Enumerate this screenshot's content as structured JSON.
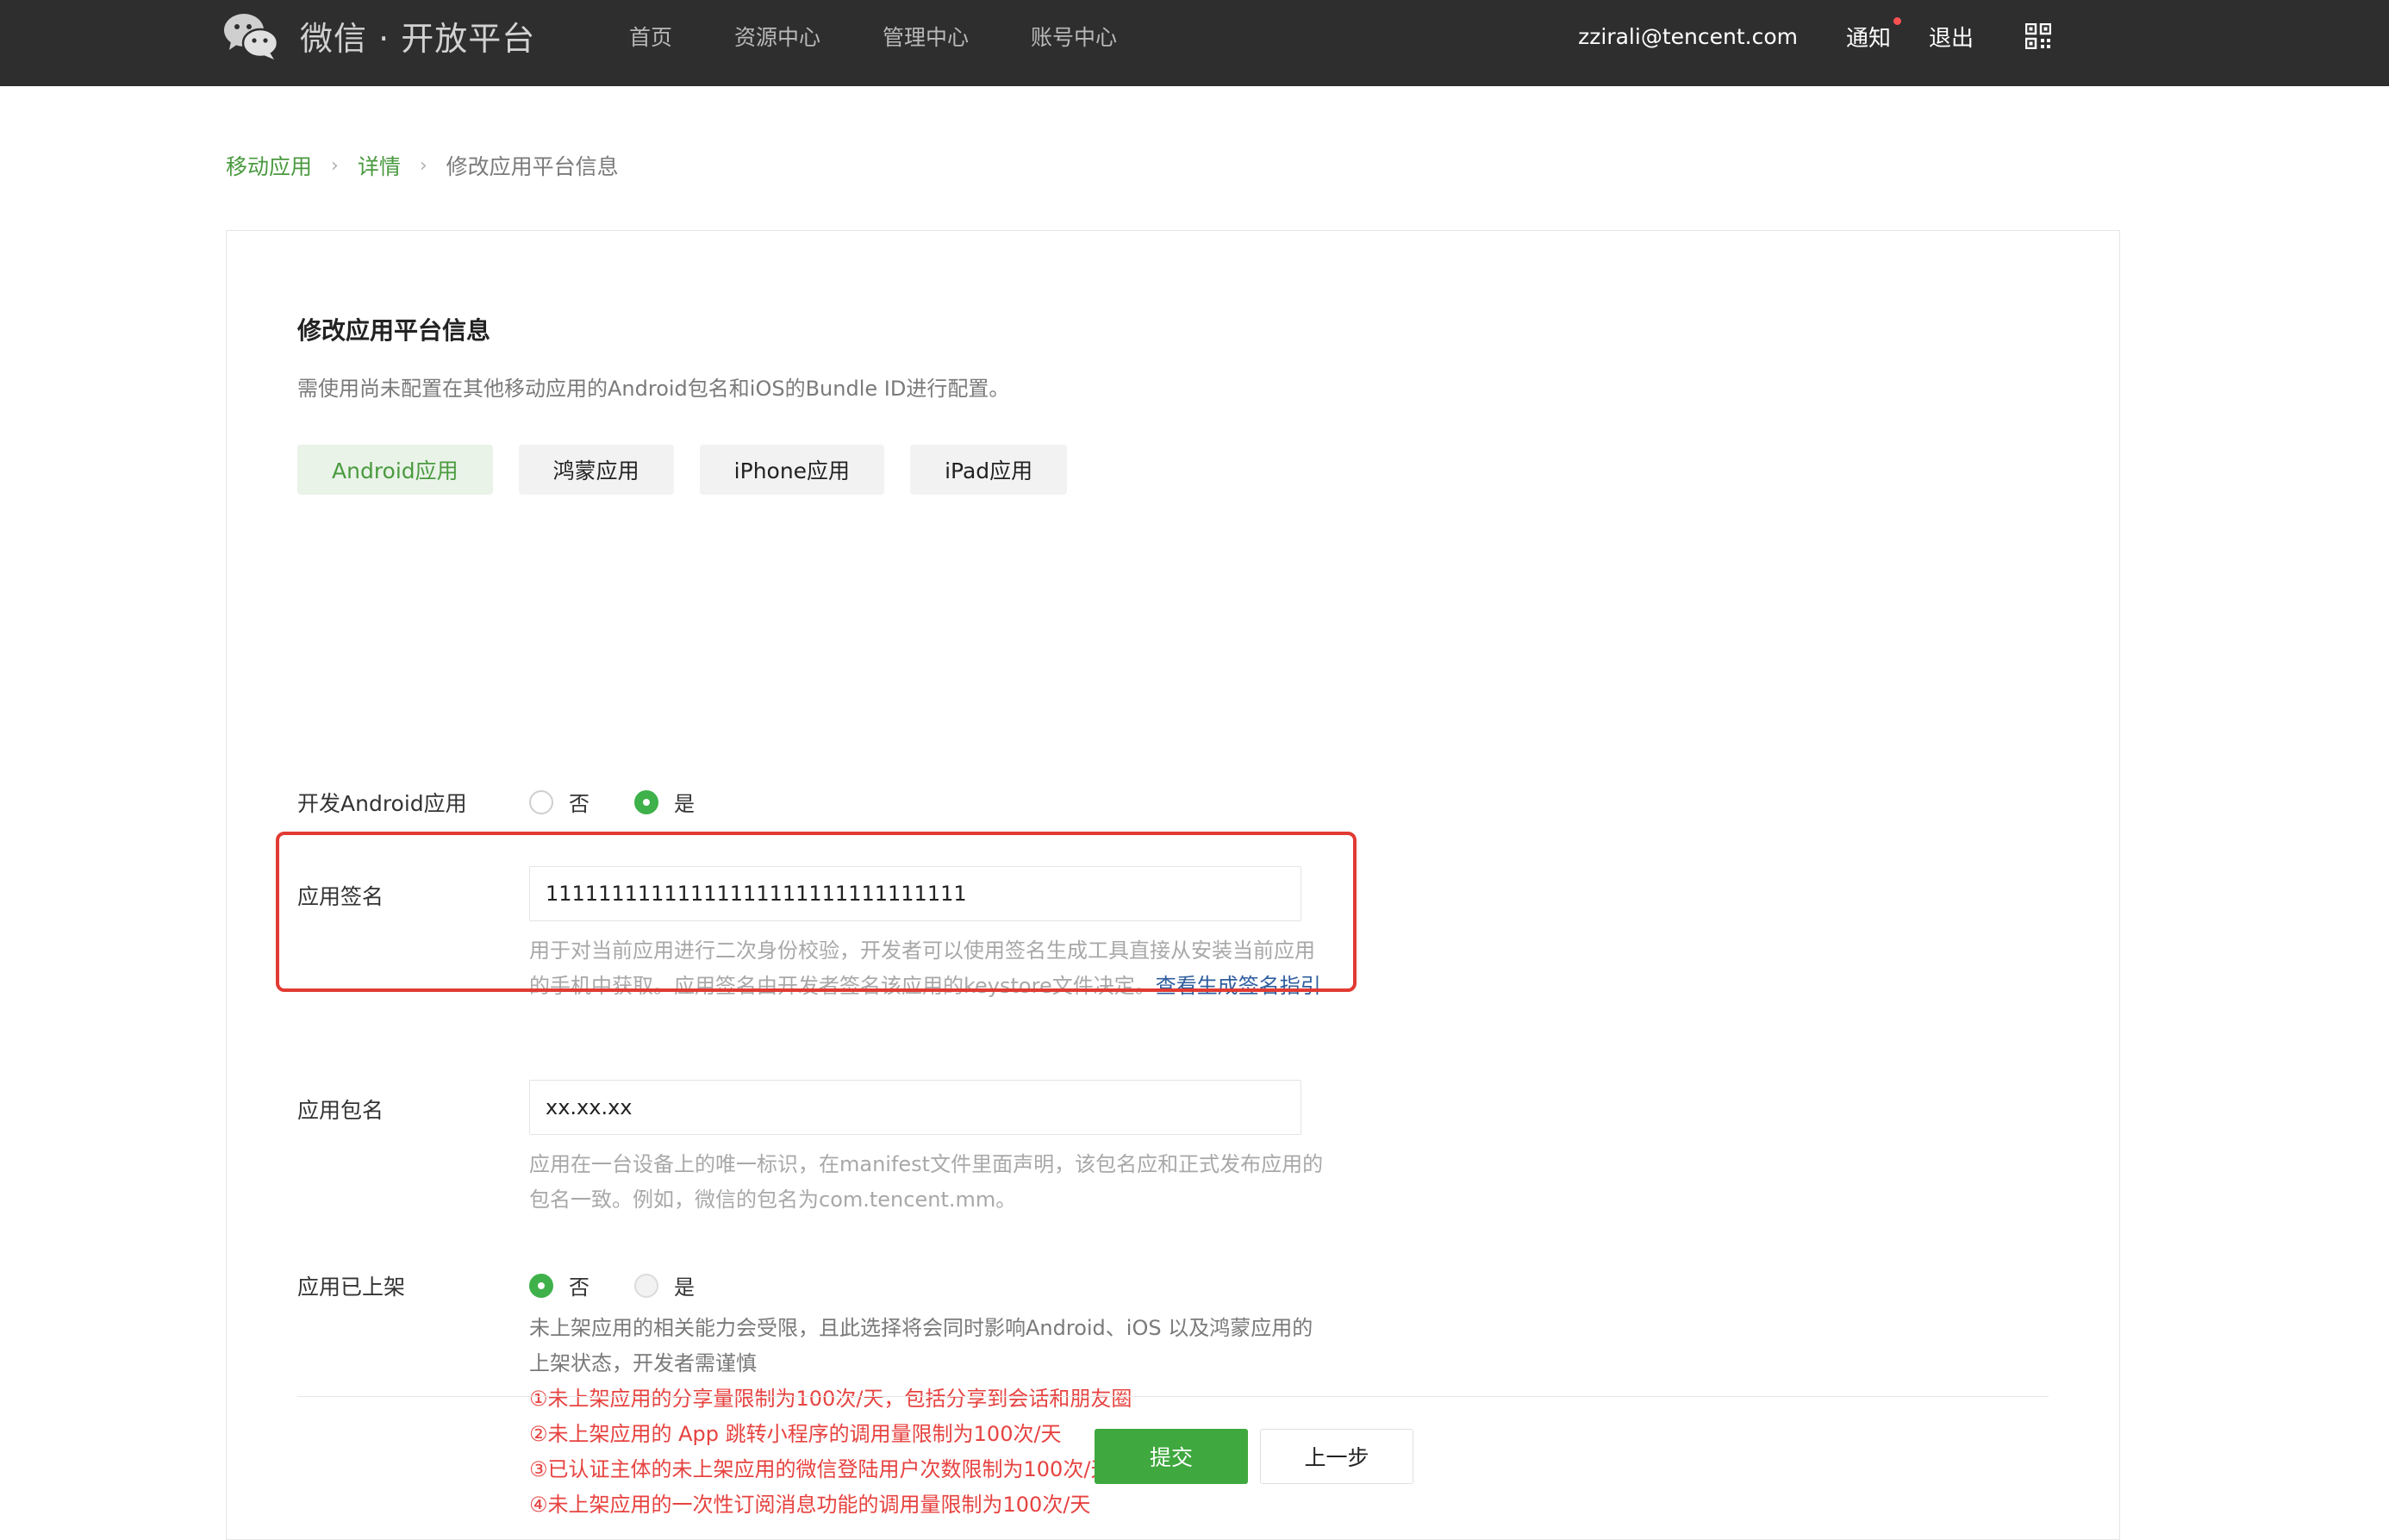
{
  "header": {
    "logo_text": "微信 · 开放平台",
    "nav": [
      "首页",
      "资源中心",
      "管理中心",
      "账号中心"
    ],
    "user_email": "zzirali@tencent.com",
    "notify_label": "通知",
    "logout_label": "退出"
  },
  "breadcrumb": {
    "level1": "移动应用",
    "level2": "详情",
    "current": "修改应用平台信息"
  },
  "form": {
    "title": "修改应用平台信息",
    "description": "需使用尚未配置在其他移动应用的Android包名和iOS的Bundle ID进行配置。",
    "tabs": [
      {
        "label": "Android应用",
        "active": true
      },
      {
        "label": "鸿蒙应用",
        "active": false
      },
      {
        "label": "iPhone应用",
        "active": false
      },
      {
        "label": "iPad应用",
        "active": false
      }
    ],
    "develop_android": {
      "label": "开发Android应用",
      "option_no": "否",
      "option_yes": "是",
      "selected": "是"
    },
    "signature": {
      "label": "应用签名",
      "value": "11111111111111111111111111111111",
      "help": "用于对当前应用进行二次身份校验，开发者可以使用签名生成工具直接从安装当前应用的手机中获取。应用签名由开发者签名该应用的keystore文件决定。",
      "help_link": "查看生成签名指引"
    },
    "package": {
      "label": "应用包名",
      "value": "xx.xx.xx",
      "help": "应用在一台设备上的唯一标识，在manifest文件里面声明，该包名应和正式发布应用的包名一致。例如，微信的包名为com.tencent.mm。"
    },
    "listed": {
      "label": "应用已上架",
      "option_no": "否",
      "option_yes": "是",
      "selected": "否",
      "note": "未上架应用的相关能力会受限，且此选择将会同时影响Android、iOS 以及鸿蒙应用的上架状态，开发者需谨慎",
      "warnings": [
        "①未上架应用的分享量限制为100次/天，包括分享到会话和朋友圈",
        "②未上架应用的 App 跳转小程序的调用量限制为100次/天",
        "③已认证主体的未上架应用的微信登陆用户次数限制为100次/天",
        "④未上架应用的一次性订阅消息功能的调用量限制为100次/天"
      ]
    },
    "submit_label": "提交",
    "back_label": "上一步"
  },
  "colors": {
    "topbar_bg": "#2e2e2e",
    "brand_green": "#3fa83f",
    "link_green": "#4a9a3f",
    "warning_red": "#e64340",
    "highlight_red": "#e13a32"
  },
  "icons": [
    "wechat-logo-icon",
    "qr-code-icon"
  ]
}
